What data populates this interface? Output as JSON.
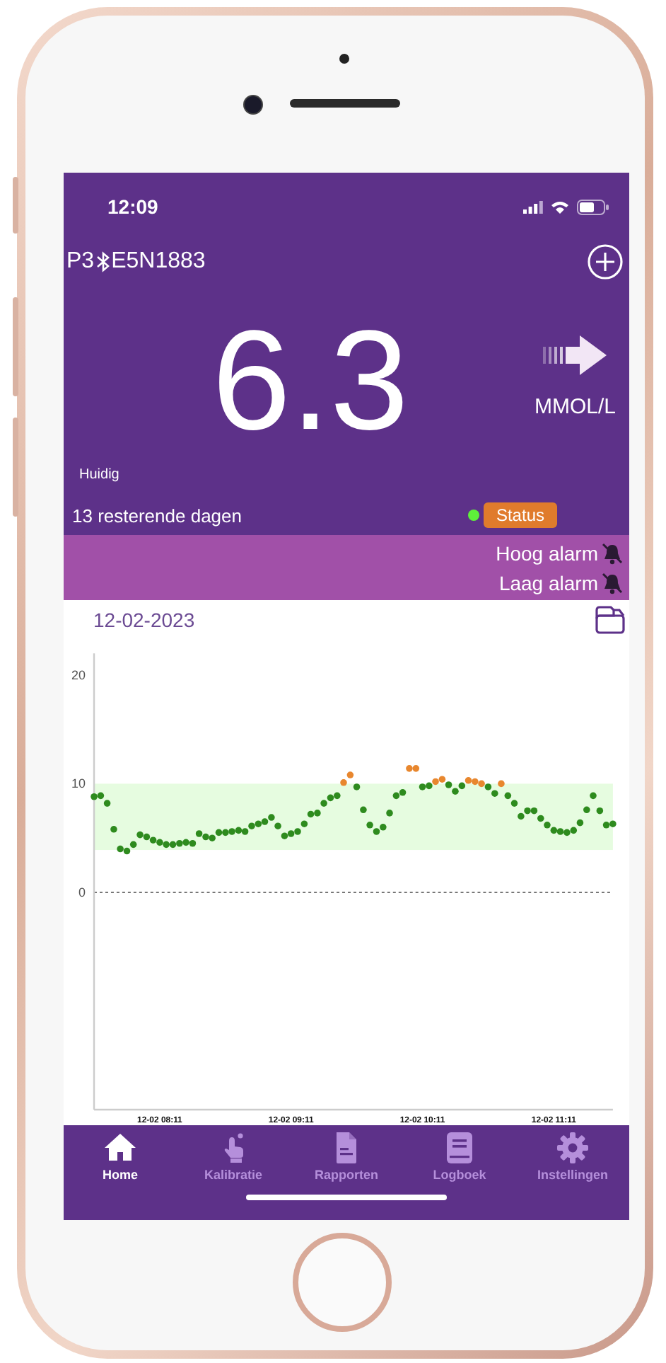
{
  "status_bar": {
    "time": "12:09"
  },
  "header": {
    "slot": "P3",
    "serial": "E5N1883"
  },
  "reading": {
    "value": "6.3",
    "unit": "MMOL/L",
    "label": "Huidig"
  },
  "sensor": {
    "remaining": "13 resterende dagen",
    "status": "Status"
  },
  "alarms": [
    {
      "label": "Hoog alarm",
      "muted": true
    },
    {
      "label": "Laag alarm",
      "muted": true
    }
  ],
  "chart": {
    "date": "12-02-2023",
    "chart_data": {
      "type": "scatter",
      "categories": [
        null,
        null,
        null,
        null,
        null,
        null,
        null,
        null,
        null,
        null,
        "12-02 08:11",
        null,
        null,
        null,
        null,
        null,
        null,
        null,
        null,
        null,
        null,
        null,
        null,
        null,
        null,
        null,
        null,
        null,
        null,
        null,
        "12-02 09:11",
        null,
        null,
        null,
        null,
        null,
        null,
        null,
        null,
        null,
        null,
        null,
        null,
        null,
        null,
        null,
        null,
        null,
        null,
        null,
        "12-02 10:11",
        null,
        null,
        null,
        null,
        null,
        null,
        null,
        null,
        null,
        null,
        null,
        null,
        null,
        null,
        null,
        null,
        null,
        null,
        null,
        "12-02 11:11",
        null,
        null,
        null,
        null,
        null,
        null,
        null,
        null,
        null
      ],
      "series": [
        {
          "color": "#2e8b1e",
          "values": [
            8.8,
            8.9,
            8.2,
            5.8,
            4.0,
            3.8,
            4.4,
            5.3,
            5.1,
            4.8,
            4.6,
            4.4,
            4.4,
            4.5,
            4.6,
            4.5,
            5.4,
            5.1,
            5.0,
            5.5,
            5.5,
            5.6,
            5.7,
            5.6,
            6.1,
            6.3,
            6.5,
            6.9,
            6.1,
            5.2,
            5.4,
            5.6,
            6.3,
            7.2,
            7.3,
            8.2,
            8.7,
            8.9,
            null,
            null,
            9.7,
            7.6,
            6.2,
            5.6,
            6.0,
            7.3,
            8.9,
            9.2,
            null,
            null,
            9.7,
            9.8,
            null,
            null,
            9.9,
            9.3,
            9.8,
            null,
            null,
            null,
            9.7,
            9.1,
            null,
            8.9,
            8.2,
            7.0,
            7.5,
            7.5,
            6.8,
            6.2,
            5.7,
            5.6,
            5.5,
            5.7,
            6.4,
            7.6,
            8.9,
            7.5,
            6.2,
            6.3
          ]
        },
        {
          "color": "#e8872e",
          "values": [
            null,
            null,
            null,
            null,
            null,
            null,
            null,
            null,
            null,
            null,
            null,
            null,
            null,
            null,
            null,
            null,
            null,
            null,
            null,
            null,
            null,
            null,
            null,
            null,
            null,
            null,
            null,
            null,
            null,
            null,
            null,
            null,
            null,
            null,
            null,
            null,
            null,
            null,
            10.1,
            10.8,
            null,
            null,
            null,
            null,
            null,
            null,
            null,
            null,
            11.4,
            11.4,
            null,
            null,
            10.2,
            10.4,
            null,
            null,
            null,
            10.3,
            10.2,
            10.0,
            null,
            null,
            10.0,
            null,
            null,
            null,
            null,
            null,
            null,
            null,
            null,
            null,
            null,
            null,
            null,
            null,
            null,
            null,
            null,
            null
          ]
        }
      ],
      "ylim": [
        -20,
        22
      ],
      "yticks": [
        0,
        10,
        20
      ],
      "bands": [
        {
          "axis": "y",
          "from": 3.9,
          "to": 10
        }
      ],
      "ref_lines": [
        {
          "axis": "y",
          "value": 0
        }
      ]
    }
  },
  "tabs": [
    {
      "label": "Home",
      "selected": true
    },
    {
      "label": "Kalibratie",
      "selected": false
    },
    {
      "label": "Rapporten",
      "selected": false
    },
    {
      "label": "Logboek",
      "selected": false
    },
    {
      "label": "Instellingen",
      "selected": false
    }
  ]
}
